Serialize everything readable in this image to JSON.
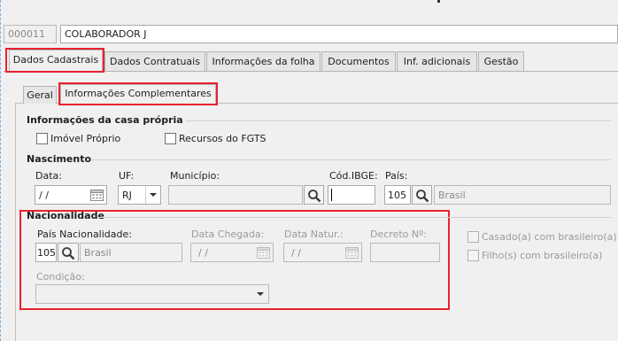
{
  "employee": {
    "code": "000011",
    "name": "COLABORADOR J"
  },
  "tabs": [
    {
      "label": "Dados Cadastrais",
      "active": true
    },
    {
      "label": "Dados Contratuais",
      "active": false
    },
    {
      "label": "Informações da folha",
      "active": false
    },
    {
      "label": "Documentos",
      "active": false
    },
    {
      "label": "Inf. adicionais",
      "active": false
    },
    {
      "label": "Gestão",
      "active": false
    }
  ],
  "subtabs": [
    {
      "label": "Geral",
      "active": false
    },
    {
      "label": "Informações Complementares",
      "active": true
    }
  ],
  "casa_propria": {
    "title": "Informações da casa própria",
    "imovel_proprio": {
      "label": "Imóvel Próprio",
      "checked": false
    },
    "recursos_fgts": {
      "label": "Recursos do FGTS",
      "checked": false
    }
  },
  "nascimento": {
    "title": "Nascimento",
    "data_label": "Data:",
    "data_value": " /  /",
    "uf_label": "UF:",
    "uf_value": "RJ",
    "municipio_label": "Município:",
    "municipio_value": "",
    "cod_ibge_label": "Cód.IBGE:",
    "cod_ibge_value": "",
    "pais_label": "País:",
    "pais_code": "105",
    "pais_name": "Brasil"
  },
  "nacionalidade": {
    "title": "Nacionalidade",
    "pais_label": "País Nacionalidade:",
    "pais_code": "105",
    "pais_name": "Brasil",
    "data_chegada_label": "Data Chegada:",
    "data_chegada_value": " /  /",
    "data_natur_label": "Data Natur.:",
    "data_natur_value": " /  /",
    "decreto_label": "Decreto Nº:",
    "decreto_value": "",
    "condicao_label": "Condição:",
    "condicao_value": "",
    "casado_label": "Casado(a) com brasileiro(a)",
    "filhos_label": "Filho(s) com brasileiro(a)"
  },
  "colors": {
    "highlight": "#e8222d",
    "background": "#f0f0f0"
  }
}
